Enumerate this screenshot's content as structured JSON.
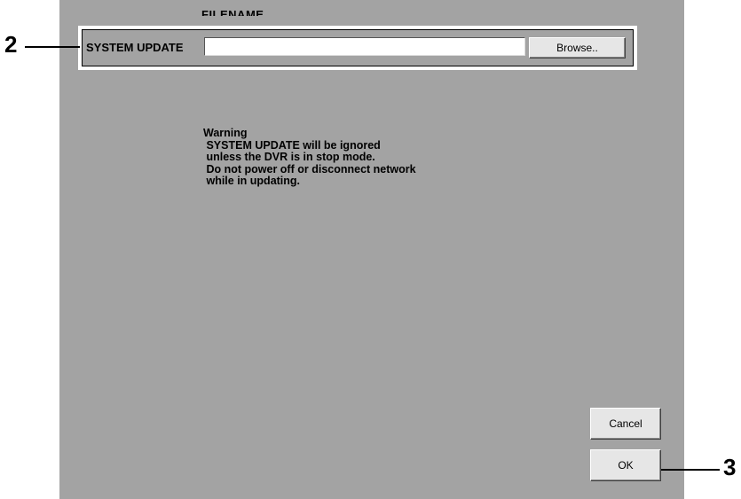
{
  "header": {
    "filename_label": "FILENAME"
  },
  "update": {
    "label": "SYSTEM UPDATE",
    "file_value": "",
    "browse_label": "Browse.."
  },
  "warning": {
    "title": "Warning",
    "lines": [
      " SYSTEM UPDATE will be ignored",
      " unless the DVR is in stop mode.",
      " Do not power off or disconnect network",
      " while in updating."
    ]
  },
  "buttons": {
    "cancel_label": "Cancel",
    "ok_label": "OK"
  },
  "callouts": {
    "left_number": "2",
    "right_number": "3"
  },
  "colors": {
    "panel_bg": "#a3a3a3",
    "button_bg": "#e6e6e6"
  }
}
